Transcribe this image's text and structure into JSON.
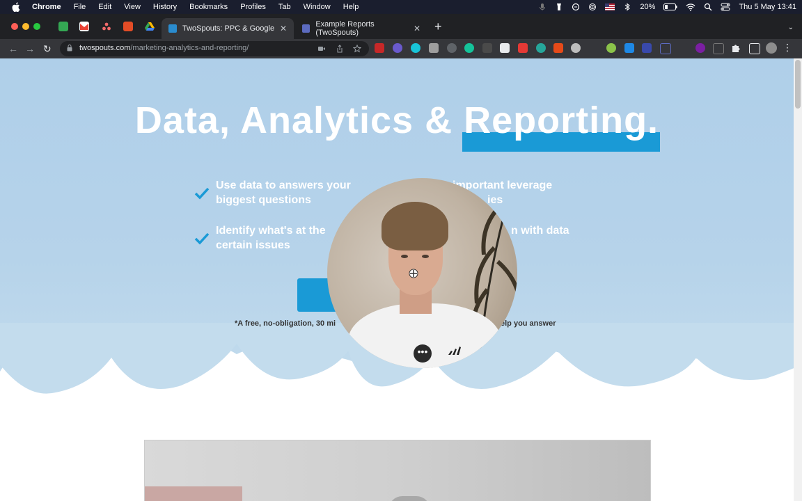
{
  "menubar": {
    "app_name": "Chrome",
    "items": [
      "File",
      "Edit",
      "View",
      "History",
      "Bookmarks",
      "Profiles",
      "Tab",
      "Window",
      "Help"
    ],
    "battery": "20%",
    "datetime": "Thu 5 May  13:41"
  },
  "tabs": [
    {
      "title": "TwoSpouts: PPC & Google",
      "active": true
    },
    {
      "title": "Example Reports (TwoSpouts)",
      "active": false
    }
  ],
  "toolbar": {
    "url_host": "twospouts.com",
    "url_path": "/marketing-analytics-and-reporting/"
  },
  "hero": {
    "headline_main": "Data, Analytics & ",
    "headline_highlight": "Reporting.",
    "bullets": [
      {
        "line1": "Use data to answers your",
        "line2": "biggest questions"
      },
      {
        "line1": "Identify what's at the",
        "line2": "certain issues"
      },
      {
        "line1": "important leverage",
        "line2": "ies"
      },
      {
        "line1": "n with data",
        "line2": ""
      }
    ],
    "footnote_left": "*A free, no-obligation, 30 mi",
    "footnote_right": "elp you answer"
  },
  "colors": {
    "accent": "#1a9ad6",
    "hero_bg": "#afcfe9"
  }
}
